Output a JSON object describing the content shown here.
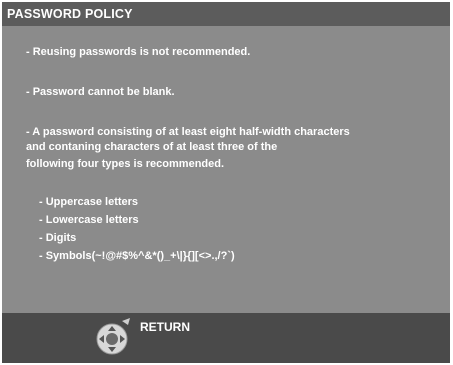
{
  "title": "PASSWORD POLICY",
  "rules": [
    "- Reusing passwords is not recommended.",
    "- Password cannot be blank.",
    "- A password consisting of at least eight half-width characters",
    "and contaning characters of at least three of the",
    "following four types is recommended."
  ],
  "types": [
    "- Uppercase letters",
    "- Lowercase letters",
    "- Digits",
    "- Symbols(~!@#$%^&*()_+\\|}{][<>.,/?`)"
  ],
  "footer": {
    "return_label": "RETURN",
    "nav_icon": "directional-pad-icon"
  },
  "colors": {
    "panel": "#8b8b8b",
    "title_bar": "#5c5c5c",
    "footer": "#4a4a4a",
    "text": "#ffffff"
  }
}
